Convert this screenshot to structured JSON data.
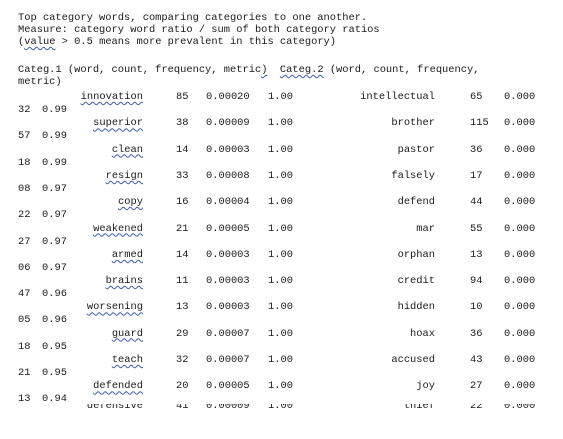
{
  "header": {
    "line1": "Top category words, comparing categories to one another.",
    "line2": "Measure: category word ratio / sum of both category ratios",
    "line3_open": "(",
    "line3_value_word": "value",
    "line3_rest": " > 0.5 means more prevalent in this category)"
  },
  "columns": {
    "part_a": "Categ.1 (word, count, frequency, metric",
    "part_b": ")",
    "categ2": "Categ.2",
    "part_c": " (word, count, frequency,",
    "part_d": "metric)"
  },
  "rows": [
    {
      "w1": "innovation",
      "c1": "85",
      "f1": "0.00020",
      "m1": "1.00",
      "w2": "intellectual",
      "c2": "65",
      "f2": "0.000",
      "t1": "32",
      "t2": "0.99"
    },
    {
      "w1": "superior",
      "c1": "38",
      "f1": "0.00009",
      "m1": "1.00",
      "w2": "brother",
      "c2": "115",
      "f2": "0.000",
      "t1": "57",
      "t2": "0.99"
    },
    {
      "w1": "clean",
      "c1": "14",
      "f1": "0.00003",
      "m1": "1.00",
      "w2": "pastor",
      "c2": "36",
      "f2": "0.000",
      "t1": "18",
      "t2": "0.99"
    },
    {
      "w1": "resign",
      "c1": "33",
      "f1": "0.00008",
      "m1": "1.00",
      "w2": "falsely",
      "c2": "17",
      "f2": "0.000",
      "t1": "08",
      "t2": "0.97"
    },
    {
      "w1": "copy",
      "c1": "16",
      "f1": "0.00004",
      "m1": "1.00",
      "w2": "defend",
      "c2": "44",
      "f2": "0.000",
      "t1": "22",
      "t2": "0.97"
    },
    {
      "w1": "weakened",
      "c1": "21",
      "f1": "0.00005",
      "m1": "1.00",
      "w2": "mar",
      "c2": "55",
      "f2": "0.000",
      "t1": "27",
      "t2": "0.97"
    },
    {
      "w1": "armed",
      "c1": "14",
      "f1": "0.00003",
      "m1": "1.00",
      "w2": "orphan",
      "c2": "13",
      "f2": "0.000",
      "t1": "06",
      "t2": "0.97"
    },
    {
      "w1": "brains",
      "c1": "11",
      "f1": "0.00003",
      "m1": "1.00",
      "w2": "credit",
      "c2": "94",
      "f2": "0.000",
      "t1": "47",
      "t2": "0.96"
    },
    {
      "w1": "worsening",
      "c1": "13",
      "f1": "0.00003",
      "m1": "1.00",
      "w2": "hidden",
      "c2": "10",
      "f2": "0.000",
      "t1": "05",
      "t2": "0.96"
    },
    {
      "w1": "guard",
      "c1": "29",
      "f1": "0.00007",
      "m1": "1.00",
      "w2": "hoax",
      "c2": "36",
      "f2": "0.000",
      "t1": "18",
      "t2": "0.95"
    },
    {
      "w1": "teach",
      "c1": "32",
      "f1": "0.00007",
      "m1": "1.00",
      "w2": "accused",
      "c2": "43",
      "f2": "0.000",
      "t1": "21",
      "t2": "0.95"
    },
    {
      "w1": "defended",
      "c1": "20",
      "f1": "0.00005",
      "m1": "1.00",
      "w2": "joy",
      "c2": "27",
      "f2": "0.000",
      "t1": "13",
      "t2": "0.94"
    }
  ],
  "colors": {
    "text": "#1a1a1a",
    "background": "#ffffff",
    "spellcheck_underline": "#3b5bb5"
  }
}
